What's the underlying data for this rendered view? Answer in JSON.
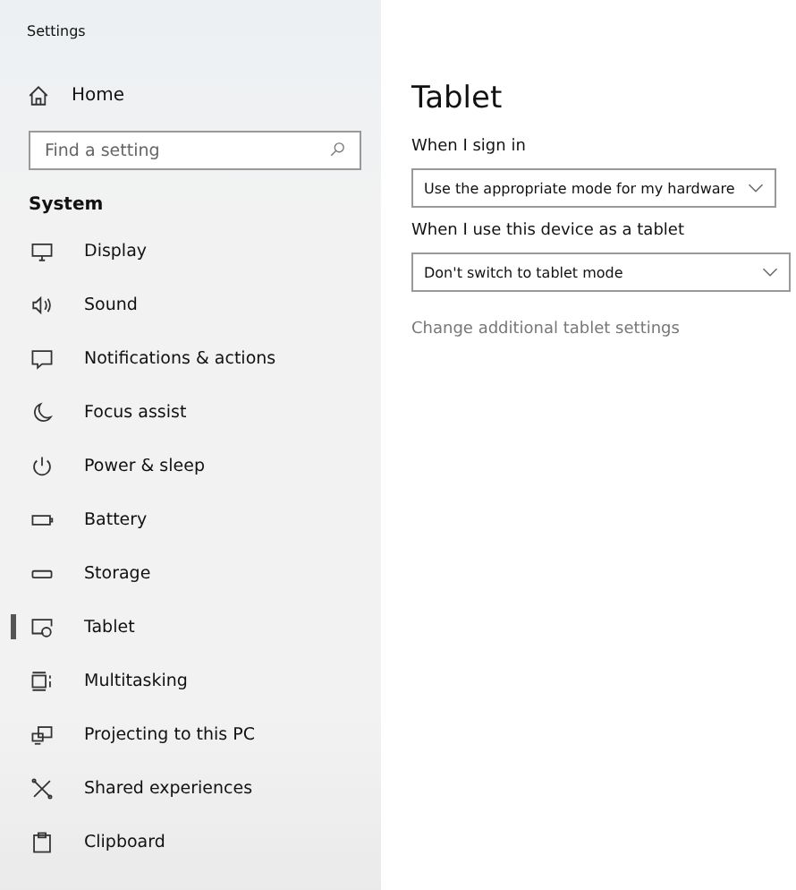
{
  "window": {
    "title": "Settings"
  },
  "sidebar": {
    "home": {
      "label": "Home"
    },
    "search": {
      "placeholder": "Find a setting"
    },
    "section": "System",
    "items": [
      {
        "label": "Display",
        "kind": "display",
        "selected": false
      },
      {
        "label": "Sound",
        "kind": "sound",
        "selected": false
      },
      {
        "label": "Notifications & actions",
        "kind": "notifications",
        "selected": false
      },
      {
        "label": "Focus assist",
        "kind": "focus",
        "selected": false
      },
      {
        "label": "Power & sleep",
        "kind": "power",
        "selected": false
      },
      {
        "label": "Battery",
        "kind": "battery",
        "selected": false
      },
      {
        "label": "Storage",
        "kind": "storage",
        "selected": false
      },
      {
        "label": "Tablet",
        "kind": "tablet",
        "selected": true
      },
      {
        "label": "Multitasking",
        "kind": "multitasking",
        "selected": false
      },
      {
        "label": "Projecting to this PC",
        "kind": "projecting",
        "selected": false
      },
      {
        "label": "Shared experiences",
        "kind": "shared",
        "selected": false
      },
      {
        "label": "Clipboard",
        "kind": "clipboard",
        "selected": false
      }
    ]
  },
  "main": {
    "title": "Tablet",
    "settings": [
      {
        "label": "When I sign in",
        "value": "Use the appropriate mode for my hardware",
        "wide": false
      },
      {
        "label": "When I use this device as a tablet",
        "value": "Don't switch to tablet mode",
        "wide": true
      }
    ],
    "link": "Change additional tablet settings"
  }
}
